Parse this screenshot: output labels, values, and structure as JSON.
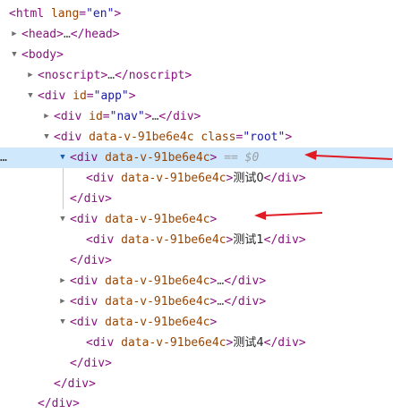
{
  "nodes": {
    "html_open": {
      "tag": "<html",
      "attr": " lang",
      "eq": "=",
      "val": "\"en\"",
      "close": ">"
    },
    "head": {
      "text": "<head>",
      "ellipsis": "…",
      "close": "</head>"
    },
    "body_open": {
      "text": "<body>"
    },
    "noscript": {
      "text": "<noscript>",
      "ellipsis": "…",
      "close": "</noscript>"
    },
    "app": {
      "tag": "<div",
      "attr": " id",
      "eq": "=",
      "val": "\"app\"",
      "close": ">"
    },
    "nav": {
      "tag": "<div",
      "attr": " id",
      "eq": "=",
      "val": "\"nav\"",
      "close": ">",
      "ellipsis": "…",
      "end": "</div>"
    },
    "root": {
      "tag": "<div",
      "attr": " data-v-91be6e4c",
      "attr2": " class",
      "eq": "=",
      "val": "\"root\"",
      "close": ">"
    },
    "item0_open": {
      "tag": "<div",
      "attr": " data-v-91be6e4c",
      "close": ">",
      "marker": " == $0",
      "dots": "…"
    },
    "item0_child": {
      "tag": "<div",
      "attr": " data-v-91be6e4c",
      "close": ">",
      "text": "测试0",
      "end": "</div>"
    },
    "item0_close": {
      "text": "</div>"
    },
    "item1_open": {
      "tag": "<div",
      "attr": " data-v-91be6e4c",
      "close": ">"
    },
    "item1_child": {
      "tag": "<div",
      "attr": " data-v-91be6e4c",
      "close": ">",
      "text": "测试1",
      "end": "</div>"
    },
    "item1_close": {
      "text": "</div>"
    },
    "item2": {
      "tag": "<div",
      "attr": " data-v-91be6e4c",
      "close": ">",
      "ellipsis": "…",
      "end": "</div>"
    },
    "item3": {
      "tag": "<div",
      "attr": " data-v-91be6e4c",
      "close": ">",
      "ellipsis": "…",
      "end": "</div>"
    },
    "item4_open": {
      "tag": "<div",
      "attr": " data-v-91be6e4c",
      "close": ">"
    },
    "item4_child": {
      "tag": "<div",
      "attr": " data-v-91be6e4c",
      "close": ">",
      "text": "测试4",
      "end": "</div>"
    },
    "item4_close": {
      "text": "</div>"
    },
    "root_close": {
      "text": "</div>"
    },
    "app_close": {
      "text": "</div>"
    }
  },
  "icons": {
    "expanded": "▼",
    "collapsed": "▶"
  },
  "colors": {
    "selection_bg": "#cfe8fc",
    "arrow_red": "#e01b24"
  }
}
